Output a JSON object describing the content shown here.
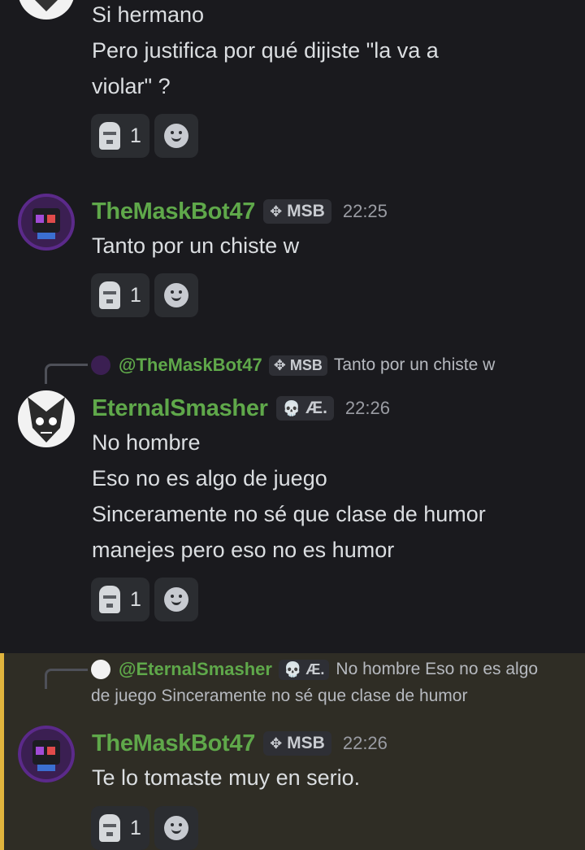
{
  "messages": [
    {
      "lines": [
        "Si hermano",
        "Pero justifica por qué dijiste \"la va a",
        "violar\" ?"
      ],
      "reaction": {
        "emoji": "moai-icon",
        "count": "1"
      }
    },
    {
      "author": "TheMaskBot47",
      "tag": "MSB",
      "time": "22:25",
      "lines": [
        "Tanto por un chiste w"
      ],
      "reaction": {
        "emoji": "moai-icon",
        "count": "1"
      }
    },
    {
      "reply": {
        "author": "@TheMaskBot47",
        "tag": "MSB",
        "text": "Tanto por un chiste w"
      },
      "author": "EternalSmasher",
      "tag": "Æ.",
      "time": "22:26",
      "lines": [
        "No hombre",
        "Eso no es algo de juego",
        "Sinceramente no sé que clase de humor",
        "manejes pero eso no es humor"
      ],
      "reaction": {
        "emoji": "moai-icon",
        "count": "1"
      }
    },
    {
      "reply": {
        "author": "@EternalSmasher",
        "tag": "Æ.",
        "text": "No hombre Eso no es algo",
        "text2": "de juego Sinceramente no sé que clase de humor"
      },
      "author": "TheMaskBot47",
      "tag": "MSB",
      "time": "22:26",
      "lines": [
        "Te lo tomaste muy en serio."
      ],
      "reaction": {
        "emoji": "moai-icon",
        "count": "1"
      }
    }
  ],
  "colors": {
    "username": "#5fa84a",
    "highlight_bar": "#e0b43d",
    "background": "#1a1a1e"
  }
}
